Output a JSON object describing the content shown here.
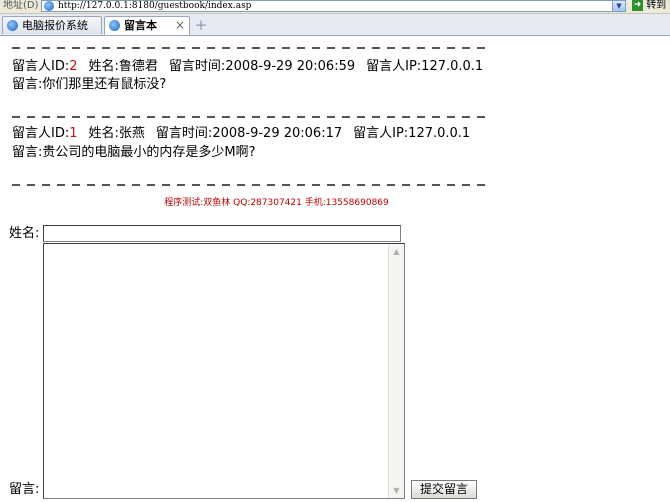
{
  "address_bar": {
    "label": "地址(D)",
    "url": "http://127.0.0.1:8180/guestbook/index.asp",
    "go_label": "转到"
  },
  "tabs": [
    {
      "label": "电脑报价系统",
      "active": false
    },
    {
      "label": "留言本",
      "active": true
    }
  ],
  "messages": [
    {
      "id_label": "留言人ID:",
      "id": "2",
      "name_label": "姓名:",
      "name": "鲁德君",
      "time_label": "留言时间:",
      "time": "2008-9-29 20:06:59",
      "ip_label": "留言人IP:",
      "ip": "127.0.0.1",
      "content_label": "留言:",
      "content": "你们那里还有鼠标没?"
    },
    {
      "id_label": "留言人ID:",
      "id": "1",
      "name_label": "姓名:",
      "name": "张燕",
      "time_label": "留言时间:",
      "time": "2008-9-29 20:06:17",
      "ip_label": "留言人IP:",
      "ip": "127.0.0.1",
      "content_label": "留言:",
      "content": "贵公司的电脑最小的内存是多少M啊?"
    }
  ],
  "credit": "程序测试:双鱼林 QQ:287307421 手机:13558690869",
  "form": {
    "name_label": "姓名:",
    "name_value": "",
    "message_label": "留言:",
    "message_value": "",
    "submit_label": "提交留言"
  },
  "colors": {
    "id_highlight": "#cc1111",
    "credit": "#c00000"
  }
}
